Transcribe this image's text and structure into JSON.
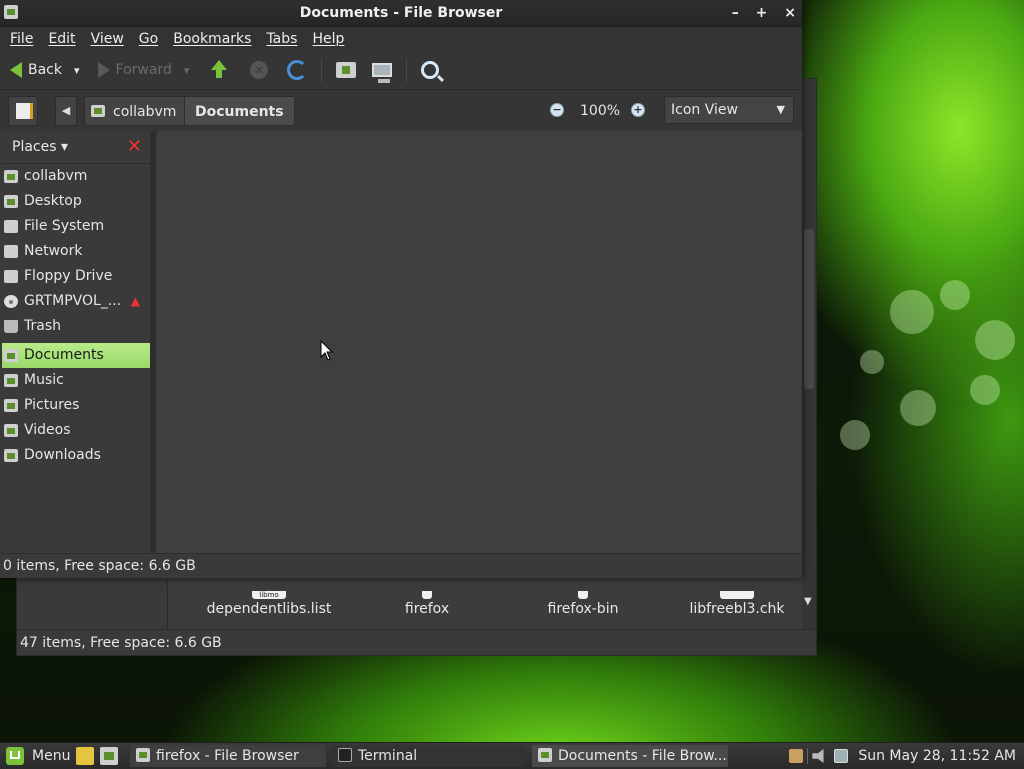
{
  "window": {
    "title": "Documents - File Browser",
    "controls": {
      "minimize": "–",
      "maximize": "+",
      "close": "×"
    }
  },
  "menubar": [
    "File",
    "Edit",
    "View",
    "Go",
    "Bookmarks",
    "Tabs",
    "Help"
  ],
  "toolbar": {
    "back_label": "Back",
    "forward_label": "Forward",
    "caret": "▾"
  },
  "location": {
    "crumb_back": "◀",
    "crumbs": [
      "collabvm",
      "Documents"
    ],
    "zoom_level": "100%",
    "zoom_out": "−",
    "zoom_in": "+",
    "view_mode": "Icon View",
    "view_caret": "▼"
  },
  "sidebar": {
    "header": "Places ▾",
    "close": "✕",
    "places": [
      {
        "label": "collabvm",
        "icon": "home-folder-icon"
      },
      {
        "label": "Desktop",
        "icon": "desktop-icon"
      },
      {
        "label": "File System",
        "icon": "drive-icon"
      },
      {
        "label": "Network",
        "icon": "network-icon"
      },
      {
        "label": "Floppy Drive",
        "icon": "floppy-icon"
      },
      {
        "label": "GRTMPVOL_...",
        "icon": "cdrom-icon",
        "eject": "▲"
      },
      {
        "label": "Trash",
        "icon": "trash-icon"
      }
    ],
    "bookmarks": [
      {
        "label": "Documents",
        "selected": true
      },
      {
        "label": "Music"
      },
      {
        "label": "Pictures"
      },
      {
        "label": "Videos"
      },
      {
        "label": "Downloads"
      }
    ]
  },
  "status": "0 items, Free space: 6.6 GB",
  "back_window": {
    "close": "×",
    "status": "47 items, Free space: 6.6 GB",
    "stub_label": "libmo",
    "files": [
      "dependentlibs.list",
      "firefox",
      "firefox-bin",
      "libfreebl3.chk"
    ],
    "scroll_arrow": "▼"
  },
  "taskbar": {
    "menu_label": "Menu",
    "tasks": [
      "firefox - File Browser",
      "Terminal",
      "Documents - File Brow..."
    ],
    "clock": "Sun May 28, 11:52 AM"
  },
  "colors": {
    "accent": "#9ad86a",
    "close_red": "#e33333",
    "back_green": "#7cc23a"
  }
}
